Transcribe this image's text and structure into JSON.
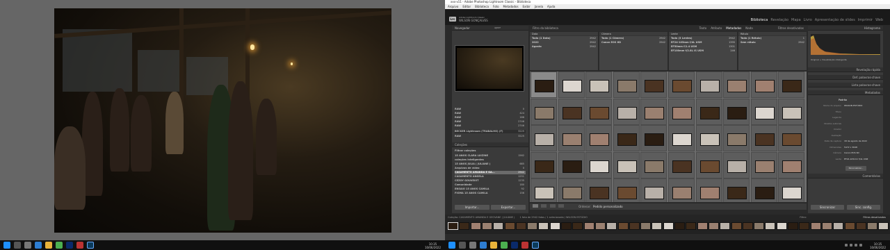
{
  "left_screen": {
    "photo": {
      "description_kind": "night-wedding-photo"
    },
    "taskbar": {
      "time": "10:35",
      "date": "10/06/2022"
    }
  },
  "right_screen": {
    "title": "xxx-v11 - Adobe Photoshop Lightroom Classic - Biblioteca",
    "menu": [
      "Arquivo",
      "Editar",
      "Biblioteca",
      "Foto",
      "Metadados",
      "Exibir",
      "Janela",
      "Ajuda"
    ],
    "identity": {
      "line1": "Adobe Lightroom Classic",
      "line2": "WILSON GONÇALVES"
    },
    "modules": [
      "Biblioteca",
      "Revelação",
      "Mapa",
      "Livro",
      "Apresentação de slides",
      "Imprimir",
      "Web"
    ],
    "left_panel": {
      "navigator_header": "Navegador",
      "navigator_options": "AJUST",
      "folders": [
        {
          "label": "RAW",
          "count": "0"
        },
        {
          "label": "RAW",
          "count": "424"
        },
        {
          "label": "RAW",
          "count": "166"
        },
        {
          "label": "RAW",
          "count": "2746"
        },
        {
          "label": "RAW",
          "count": "2746"
        }
      ],
      "catalog_row": {
        "label": "BECKER Lightroom (TRABALHO) (F)",
        "count": "3225"
      },
      "catalog_sub": {
        "label": "RAW",
        "count": "3225"
      },
      "collections_header": "Coleções",
      "collections": [
        {
          "label": "Filtrar coleções",
          "count": ""
        },
        {
          "label": "15 ANOS CLARA LUIZINE",
          "count": "1562"
        },
        {
          "label": "coleções inteligentes",
          "count": ""
        },
        {
          "label": "15 ANOS JULIA ( JULIANE )",
          "count": "685"
        },
        {
          "label": "Arquivos de vídeo",
          "count": "0"
        },
        {
          "label": "CASAMENTO AMANDA E GA...",
          "count": "2942"
        },
        {
          "label": "CASAMENTO ANGELA",
          "count": "1251"
        },
        {
          "label": "CEZOY GOUVEIOT",
          "count": "1235"
        },
        {
          "label": "Comunidade",
          "count": "180"
        },
        {
          "label": "ENSAIO 15 ANOS CAMILA",
          "count": "92"
        },
        {
          "label": "FIGMA 15 ANOS CAMILA",
          "count": "156"
        }
      ],
      "import_button": "Importar...",
      "export_button": "Exportar..."
    },
    "filter_bar": {
      "label": "Filtro da biblioteca",
      "options": [
        "Texto",
        "Atributo",
        "Metadados",
        "Nada"
      ],
      "active": "Metadados",
      "preset": "Filtros desativados"
    },
    "metadata_columns": [
      {
        "header": "Data",
        "items": [
          {
            "label": "Todo (1 Data)",
            "count": "2942"
          },
          {
            "label": "2022",
            "count": "2942"
          },
          {
            "label": "Agosto",
            "count": "2942"
          }
        ]
      },
      {
        "header": "Câmera",
        "items": [
          {
            "label": "Todo (1 Câmera)",
            "count": "2942"
          },
          {
            "label": "Canon EOS 6D",
            "count": "2942"
          }
        ]
      },
      {
        "header": "Lente",
        "items": [
          {
            "label": "Todo (3 Lentes)",
            "count": "2942"
          },
          {
            "label": "EF24-105mm f/4L USM",
            "count": "1395"
          },
          {
            "label": "EF50mm f/1.4 USM",
            "count": "1301"
          },
          {
            "label": "EF100mm f/2.8L IS USM",
            "count": "246"
          }
        ]
      },
      {
        "header": "Rótulo",
        "items": [
          {
            "label": "Todo (1 Rótulo)",
            "count": "1"
          },
          {
            "label": "Sem rótulo",
            "count": "2942"
          }
        ]
      }
    ],
    "toolbar": {
      "sort_label": "Ordenar:",
      "sort_value": "Pedido personalizado"
    },
    "right_panel": {
      "histogram_header": "Histograma",
      "original_label": "Original + Visualização inteligente",
      "quick_develop_header": "Revelação rápida",
      "keywording_header": "Def. palavras-chave",
      "keyword_list_header": "Lista palavras-chave",
      "metadata_header": "Metadados",
      "metadata_preset": "Padrão",
      "metadata_rows": [
        {
          "label": "Nome do arquivo",
          "value": "WILSON ESTÚDIO"
        },
        {
          "label": "Título",
          "value": ""
        },
        {
          "label": "Legenda",
          "value": ""
        },
        {
          "label": "Direitos autorais",
          "value": ""
        },
        {
          "label": "Criador",
          "value": ""
        },
        {
          "label": "Avaliação",
          "value": ""
        },
        {
          "label": "Data da captura",
          "value": "18 de agosto de 2022"
        },
        {
          "label": "Dimensões",
          "value": "5472 x 3648"
        },
        {
          "label": "Câmera",
          "value": "Canon EOS 6D"
        },
        {
          "label": "Lente",
          "value": "EF24-105mm f/4L USM"
        }
      ],
      "customize_button": "Personalizar...",
      "comments_header": "Comentários",
      "sync_button": "Sincronizar",
      "sync_settings_button": "Sinc. config."
    },
    "filmstrip_bar": {
      "source": "Coleção: CASAMENTO AMANDA E GEOVANE ( JULIANE )",
      "count": "1 foto de 2942 fotos / 1 selecionada / WILSON ESTÚDIO",
      "filter_label": "Filtro:",
      "filter_value": "Filtros desativados"
    },
    "taskbar": {
      "time": "10:35",
      "date": "10/06/2022"
    }
  }
}
